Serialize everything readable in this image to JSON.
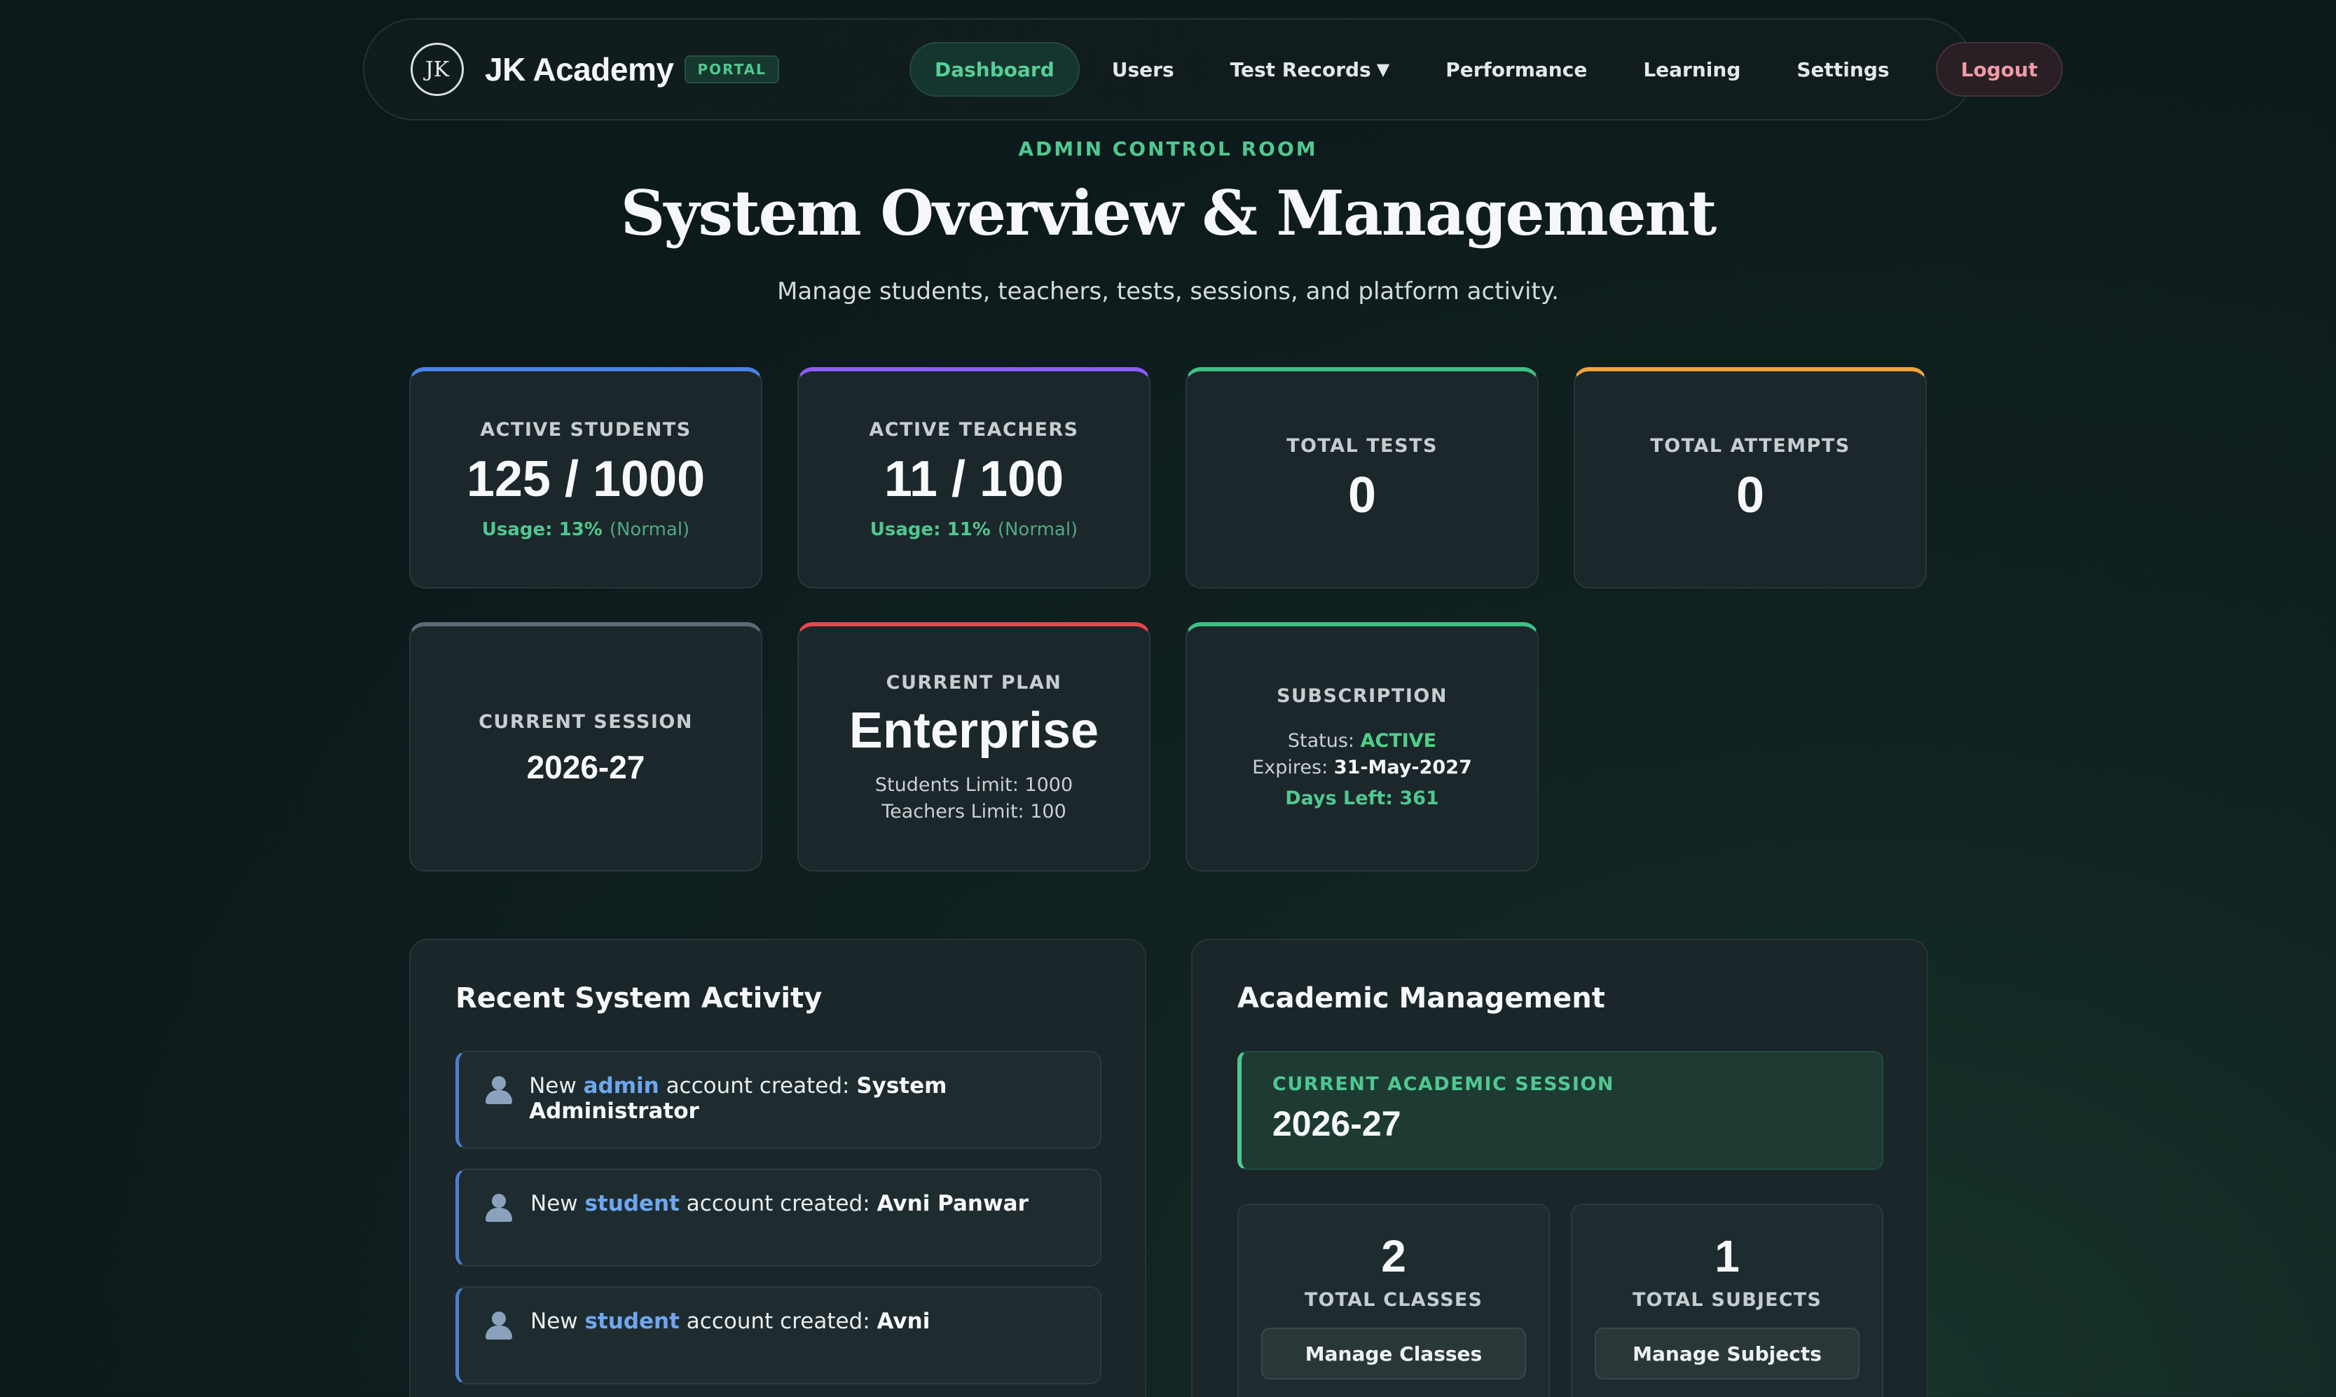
{
  "nav": {
    "logo_text": "JK",
    "brand": "JK Academy",
    "badge": "PORTAL",
    "links": [
      {
        "label": "Dashboard"
      },
      {
        "label": "Users"
      },
      {
        "label": "Test Records"
      },
      {
        "label": "Performance"
      },
      {
        "label": "Learning"
      },
      {
        "label": "Settings"
      },
      {
        "label": "Logout"
      }
    ]
  },
  "hero": {
    "eyebrow": "ADMIN CONTROL ROOM",
    "title": "System Overview & Management",
    "subtitle": "Manage students, teachers, tests, sessions, and platform activity."
  },
  "stats": {
    "students": {
      "label": "ACTIVE STUDENTS",
      "value": "125 / 1000",
      "usage": "Usage: 13%",
      "status": "(Normal)"
    },
    "teachers": {
      "label": "ACTIVE TEACHERS",
      "value": "11 / 100",
      "usage": "Usage: 11%",
      "status": "(Normal)"
    },
    "tests": {
      "label": "TOTAL TESTS",
      "value": "0"
    },
    "attempts": {
      "label": "TOTAL ATTEMPTS",
      "value": "0"
    },
    "session": {
      "label": "CURRENT SESSION",
      "value": "2026-27"
    },
    "plan": {
      "label": "CURRENT PLAN",
      "value": "Enterprise",
      "students_limit": "Students Limit: 1000",
      "teachers_limit": "Teachers Limit: 100"
    },
    "subscription": {
      "label": "SUBSCRIPTION",
      "status_label": "Status:",
      "status": "ACTIVE",
      "expires_label": "Expires:",
      "expires": "31-May-2027",
      "days_left": "Days Left: 361"
    }
  },
  "activity": {
    "title": "Recent System Activity",
    "items": [
      {
        "prefix": "New",
        "role": "admin",
        "middle": "account created:",
        "name": "System Administrator"
      },
      {
        "prefix": "New",
        "role": "student",
        "middle": "account created:",
        "name": "Avni Panwar"
      },
      {
        "prefix": "New",
        "role": "student",
        "middle": "account created:",
        "name": "Avni"
      }
    ]
  },
  "academic": {
    "title": "Academic Management",
    "session_label": "CURRENT ACADEMIC SESSION",
    "session_value": "2026-27",
    "classes": {
      "count": "2",
      "label": "TOTAL CLASSES",
      "button": "Manage Classes"
    },
    "subjects": {
      "count": "1",
      "label": "TOTAL SUBJECTS",
      "button": "Manage Subjects"
    }
  },
  "colors": {
    "accent_green": "#4fc890",
    "accent_blue": "#4a7fd4",
    "students_top": "#4a82e8",
    "teachers_top": "#8b5cf6",
    "tests_top": "#3fbf86",
    "attempts_top": "#f0a33a",
    "session_top": "#5d6a74",
    "plan_top": "#e5484d",
    "subscription_top": "#3fbf86"
  }
}
